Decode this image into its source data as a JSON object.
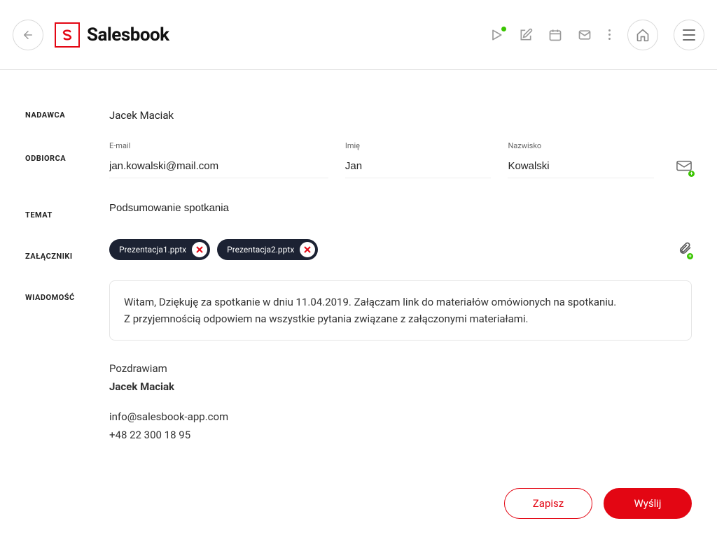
{
  "brand": {
    "name": "Salesbook"
  },
  "labels": {
    "sender": "NADAWCA",
    "recipient": "ODBIORCA",
    "subject": "TEMAT",
    "attachments": "ZAŁĄCZNIKI",
    "message": "WIADOMOŚĆ",
    "email": "E-mail",
    "first_name": "Imię",
    "last_name": "Nazwisko"
  },
  "sender": {
    "name": "Jacek Maciak"
  },
  "recipient": {
    "email": "jan.kowalski@mail.com",
    "first_name": "Jan",
    "last_name": "Kowalski"
  },
  "subject": "Podsumowanie spotkania",
  "attachments": [
    "Prezentacja1.pptx",
    "Prezentacja2.pptx"
  ],
  "message": {
    "line1": "Witam, Dziękuję za spotkanie w dniu 11.04.2019. Załączam link do materiałów omówionych na spotkaniu.",
    "line2": "Z przyjemnością odpowiem na wszystkie pytania związane z załączonymi materiałami."
  },
  "signature": {
    "greeting": "Pozdrawiam",
    "name": "Jacek Maciak",
    "email": "info@salesbook-app.com",
    "phone": "+48 22 300 18 95"
  },
  "buttons": {
    "save": "Zapisz",
    "send": "Wyślij"
  }
}
